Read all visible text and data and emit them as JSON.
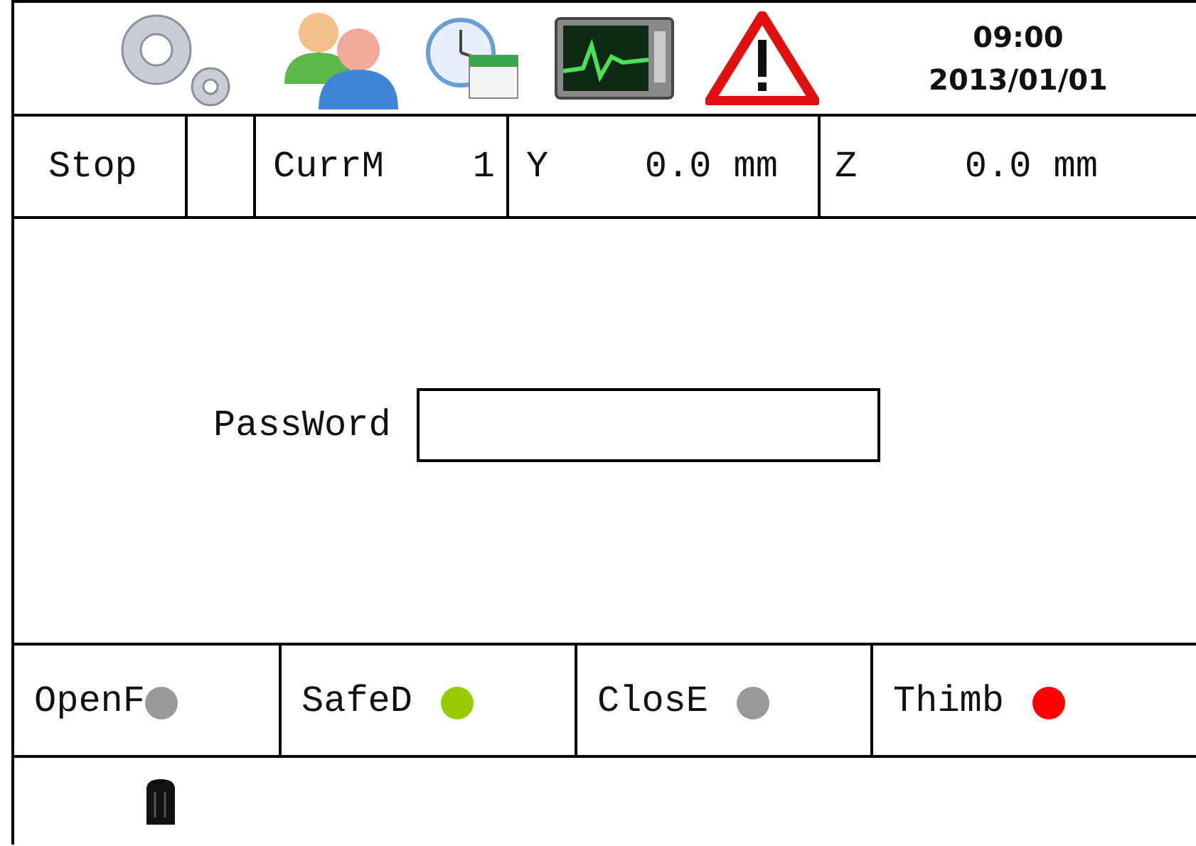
{
  "header": {
    "time": "09:00",
    "date": "2013/01/01"
  },
  "status": {
    "mode": "Stop",
    "current": {
      "label": "CurrM",
      "value": "1"
    },
    "axes": [
      {
        "label": "Y",
        "value": "0.0",
        "unit": "mm"
      },
      {
        "label": "Z",
        "value": "0.0",
        "unit": "mm"
      }
    ]
  },
  "password": {
    "label": "PassWord"
  },
  "indicators": [
    {
      "label": "OpenF",
      "color": "#999999"
    },
    {
      "label": "SafeD",
      "color": "#99cc00"
    },
    {
      "label": "ClosE",
      "color": "#999999"
    },
    {
      "label": "Thimb",
      "color": "#ff0000"
    }
  ]
}
